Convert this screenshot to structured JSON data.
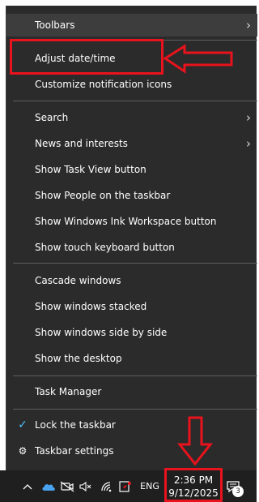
{
  "menu": {
    "items": [
      {
        "label": "Toolbars",
        "submenu": true
      },
      {
        "label": "Adjust date/time",
        "submenu": false
      },
      {
        "label": "Customize notification icons",
        "submenu": false
      },
      {
        "label": "Search",
        "submenu": true
      },
      {
        "label": "News and interests",
        "submenu": true
      },
      {
        "label": "Show Task View button",
        "submenu": false
      },
      {
        "label": "Show People on the taskbar",
        "submenu": false
      },
      {
        "label": "Show Windows Ink Workspace button",
        "submenu": false
      },
      {
        "label": "Show touch keyboard button",
        "submenu": false
      },
      {
        "label": "Cascade windows",
        "submenu": false
      },
      {
        "label": "Show windows stacked",
        "submenu": false
      },
      {
        "label": "Show windows side by side",
        "submenu": false
      },
      {
        "label": "Show the desktop",
        "submenu": false
      },
      {
        "label": "Task Manager",
        "submenu": false
      },
      {
        "label": "Lock the taskbar",
        "checked": true
      },
      {
        "label": "Taskbar settings",
        "icon": "gear-icon"
      }
    ],
    "submenu_glyph": "›",
    "check_glyph": "✓",
    "gear_glyph": "⚙"
  },
  "taskbar": {
    "language": "ENG",
    "time": "2:36 PM",
    "date": "9/12/2025",
    "notification_count": "3",
    "tray_icons": [
      "chevron-up-icon",
      "onedrive-icon",
      "meet-now-off-icon",
      "volume-muted-icon",
      "wifi-icon",
      "windows-ink-icon"
    ]
  },
  "annotations": {
    "color": "#e8131c"
  }
}
